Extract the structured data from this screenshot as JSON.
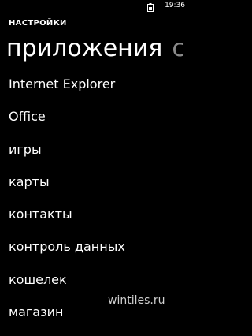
{
  "status_bar": {
    "battery_icon": "battery-icon",
    "time": "19:36"
  },
  "header": {
    "section_title": "НАСТРОЙКИ"
  },
  "pivot": {
    "active_label": "приложения",
    "next_label": "с"
  },
  "list": [
    {
      "label": "Internet Explorer"
    },
    {
      "label": "Office"
    },
    {
      "label": "игры"
    },
    {
      "label": "карты"
    },
    {
      "label": "контакты"
    },
    {
      "label": "контроль данных"
    },
    {
      "label": "кошелек"
    },
    {
      "label": "магазин"
    }
  ],
  "watermark": "wintiles.ru",
  "colors": {
    "background": "#000000",
    "text": "#ffffff",
    "inactive_pivot": "#8a8a8a"
  }
}
